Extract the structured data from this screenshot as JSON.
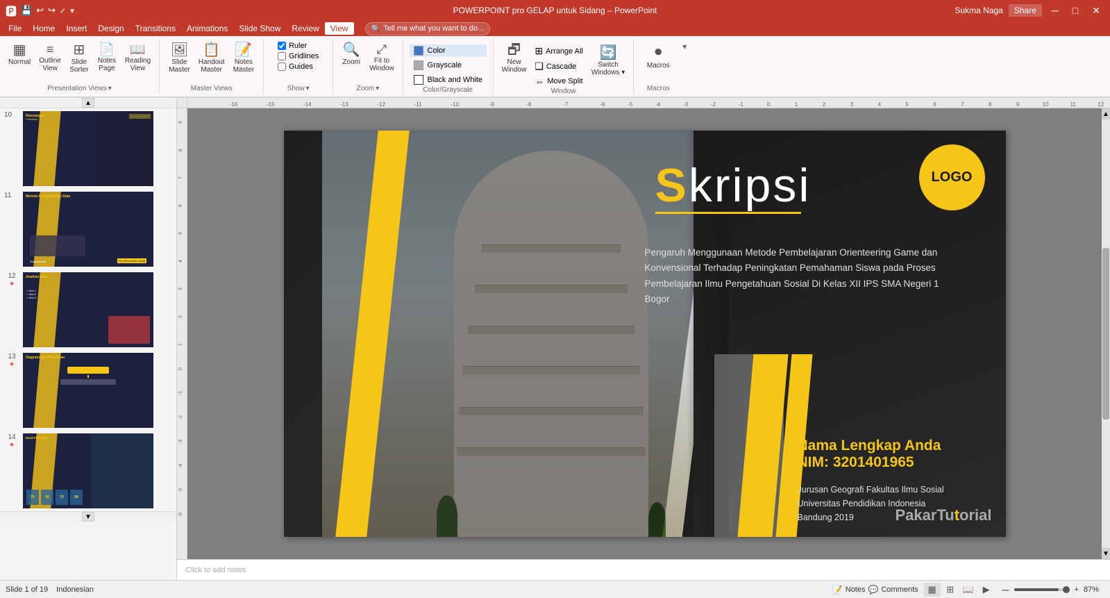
{
  "titlebar": {
    "title": "POWERPOINT pro GELAP untuk Sidang – PowerPoint",
    "user": "Sukma Naga",
    "share": "Share",
    "btns": [
      "─",
      "□",
      "✕"
    ],
    "qs_buttons": [
      "💾",
      "↩",
      "↪",
      "✓",
      "💾",
      "▾"
    ]
  },
  "menu": {
    "items": [
      "File",
      "Home",
      "Insert",
      "Design",
      "Transitions",
      "Animations",
      "Slide Show",
      "Review",
      "View"
    ],
    "active": "View",
    "tell_me": "Tell me what you want to do..."
  },
  "ribbon": {
    "groups": [
      {
        "name": "Presentation Views",
        "label": "Presentation Views",
        "buttons": [
          {
            "id": "normal",
            "icon": "▦",
            "label": "Normal"
          },
          {
            "id": "outline-view",
            "icon": "☰",
            "label": "Outline\nView"
          },
          {
            "id": "slide-sorter",
            "icon": "⊞",
            "label": "Slide\nSorter"
          },
          {
            "id": "notes-page",
            "icon": "📄",
            "label": "Notes\nPage"
          },
          {
            "id": "reading-view",
            "icon": "📖",
            "label": "Reading\nView"
          }
        ]
      },
      {
        "name": "Master Views",
        "label": "Master Views",
        "buttons": [
          {
            "id": "slide-master",
            "icon": "🖼",
            "label": "Slide\nMaster"
          },
          {
            "id": "handout-master",
            "icon": "📋",
            "label": "Handout\nMaster"
          },
          {
            "id": "notes-master",
            "icon": "📝",
            "label": "Notes\nMaster"
          }
        ]
      },
      {
        "name": "Show",
        "label": "Show",
        "checkboxes": [
          {
            "id": "ruler",
            "label": "Ruler",
            "checked": true
          },
          {
            "id": "gridlines",
            "label": "Gridlines",
            "checked": false
          },
          {
            "id": "guides",
            "label": "Guides",
            "checked": false
          }
        ]
      },
      {
        "name": "Zoom",
        "label": "Zoom",
        "buttons": [
          {
            "id": "zoom",
            "icon": "🔍",
            "label": "Zoom"
          },
          {
            "id": "fit-to-window",
            "icon": "⤢",
            "label": "Fit to\nWindow"
          }
        ]
      },
      {
        "name": "Color/Grayscale",
        "label": "Color/Grayscale",
        "color_buttons": [
          {
            "id": "color",
            "label": "Color",
            "color": "#4472c4",
            "active": true
          },
          {
            "id": "grayscale",
            "label": "Grayscale",
            "color": "#888"
          },
          {
            "id": "black-and-white",
            "label": "Black and White",
            "color": "#111"
          }
        ]
      },
      {
        "name": "Window",
        "label": "Window",
        "buttons": [
          {
            "id": "new-window",
            "icon": "🗗",
            "label": "New\nWindow"
          },
          {
            "id": "arrange-all",
            "icon": "⊞",
            "label": "Arrange All"
          },
          {
            "id": "cascade",
            "icon": "❏",
            "label": "Cascade"
          },
          {
            "id": "move-split",
            "icon": "⇔",
            "label": "Move Split"
          },
          {
            "id": "switch-windows",
            "icon": "🔄",
            "label": "Switch\nWindows ▾"
          }
        ]
      },
      {
        "name": "Macros",
        "label": "Macros",
        "buttons": [
          {
            "id": "macros",
            "icon": "⏺",
            "label": "Macros"
          }
        ]
      }
    ]
  },
  "slide_panel": {
    "scroll_up": "▲",
    "scroll_down": "▼",
    "slides": [
      {
        "num": 10,
        "starred": false,
        "title": "Rancangan Penelitian",
        "bg": "#1a1a2e",
        "has_yellow": true,
        "label": "Pro Lapangan"
      },
      {
        "num": 11,
        "starred": false,
        "title": "Metode Pengumpulan Data",
        "bg": "#1a1a2e",
        "has_yellow": true
      },
      {
        "num": 12,
        "starred": true,
        "title": "Analisis Data",
        "bg": "#1a1a2e",
        "has_yellow": true
      },
      {
        "num": 13,
        "starred": true,
        "title": "Diagram Alur Penelitian",
        "bg": "#1a1a2e",
        "has_yellow": true
      },
      {
        "num": 14,
        "starred": true,
        "title": "Hasil Penelitian",
        "bg": "#1a1a2e",
        "has_yellow": true
      }
    ]
  },
  "main_slide": {
    "logo_text": "LOGO",
    "skripsi": "Skripsi",
    "skripsi_s": "S",
    "yellow_underline": true,
    "subtitle": "Pengaruh Menggunaan Metode Pembelajaran Orienteering Game dan Konvensional Terhadap Peningkatan Pemahaman Siswa pada Proses Pembelajaran Ilmu Pengetahuan Sosial Di Kelas XII IPS SMA Negeri 1 Bogor",
    "student_name": "Nama Lengkap Anda",
    "student_nim": "NIM: 3201401965",
    "dept1": "Jurusan Geografi  Fakultas Ilmu Sosial",
    "dept2": "Universitas Pendidikan Indonesia",
    "dept3": "Bandung 2019",
    "watermark": "PakarTutorial"
  },
  "status_bar": {
    "slide_info": "Slide 1 of 19",
    "language": "Indonesian",
    "notes": "Notes",
    "comments": "Comments",
    "views": [
      "Normal",
      "Slide Sorter",
      "Reading View",
      "Slide Show"
    ],
    "zoom_minus": "─",
    "zoom_plus": "+",
    "zoom_value": "87%"
  },
  "notes_bar": {
    "placeholder": "Click to add notes"
  },
  "colors": {
    "accent": "#f5c518",
    "bg_dark": "#1e1e1e",
    "ribbon_active": "#c0392b",
    "text_light": "#e0e0e0"
  }
}
